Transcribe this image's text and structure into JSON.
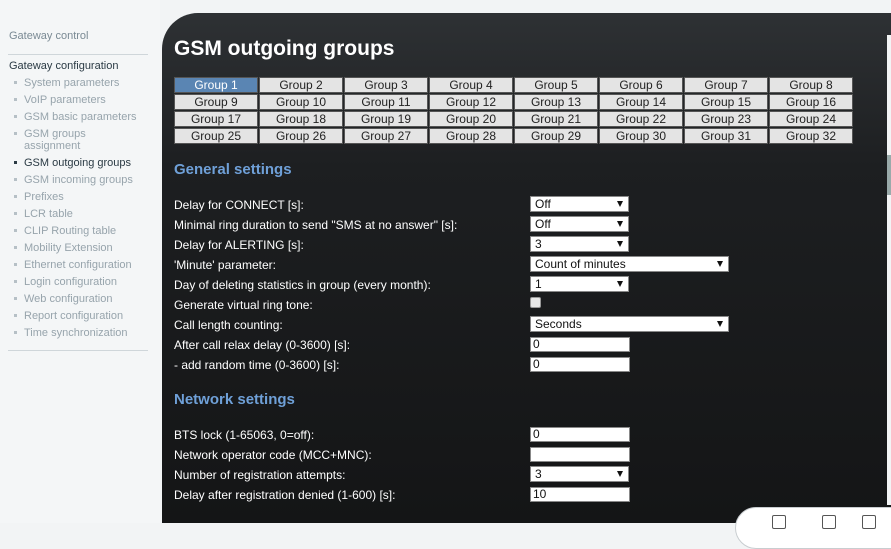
{
  "sidebar": {
    "top_link": "Gateway control",
    "section": "Gateway configuration",
    "items": [
      {
        "label": "System parameters",
        "active": false
      },
      {
        "label": "VoIP parameters",
        "active": false
      },
      {
        "label": "GSM basic parameters",
        "active": false
      },
      {
        "label": "GSM groups assignment",
        "active": false
      },
      {
        "label": "GSM outgoing groups",
        "active": true
      },
      {
        "label": "GSM incoming groups",
        "active": false
      },
      {
        "label": "Prefixes",
        "active": false
      },
      {
        "label": "LCR table",
        "active": false
      },
      {
        "label": "CLIP Routing table",
        "active": false
      },
      {
        "label": "Mobility Extension",
        "active": false
      },
      {
        "label": "Ethernet configuration",
        "active": false
      },
      {
        "label": "Login configuration",
        "active": false
      },
      {
        "label": "Web configuration",
        "active": false
      },
      {
        "label": "Report configuration",
        "active": false
      },
      {
        "label": "Time synchronization",
        "active": false
      }
    ]
  },
  "main": {
    "title": "GSM outgoing groups",
    "groups": [
      "Group 1",
      "Group 2",
      "Group 3",
      "Group 4",
      "Group 5",
      "Group 6",
      "Group 7",
      "Group 8",
      "Group 9",
      "Group 10",
      "Group 11",
      "Group 12",
      "Group 13",
      "Group 14",
      "Group 15",
      "Group 16",
      "Group 17",
      "Group 18",
      "Group 19",
      "Group 20",
      "Group 21",
      "Group 22",
      "Group 23",
      "Group 24",
      "Group 25",
      "Group 26",
      "Group 27",
      "Group 28",
      "Group 29",
      "Group 30",
      "Group 31",
      "Group 32"
    ],
    "active_group": "Group 1",
    "general": {
      "title": "General settings",
      "delay_connect": {
        "label": "Delay for CONNECT [s]:",
        "value": "Off"
      },
      "min_ring": {
        "label": "Minimal ring duration to send \"SMS at no answer\" [s]:",
        "value": "Off"
      },
      "delay_alerting": {
        "label": "Delay for ALERTING [s]:",
        "value": "3"
      },
      "minute_param": {
        "label": "'Minute' parameter:",
        "value": "Count of minutes"
      },
      "day_delete": {
        "label": "Day of deleting statistics in group (every month):",
        "value": "1"
      },
      "virtual_ring": {
        "label": "Generate virtual ring tone:",
        "checked": false
      },
      "call_length": {
        "label": "Call length counting:",
        "value": "Seconds"
      },
      "relax_delay": {
        "label": "After call relax delay (0-3600) [s]:",
        "value": "0"
      },
      "random_time": {
        "label": "- add random time (0-3600) [s]:",
        "value": "0"
      }
    },
    "network": {
      "title": "Network settings",
      "bts_lock": {
        "label": "BTS lock (1-65063, 0=off):",
        "value": "0"
      },
      "operator_code": {
        "label": "Network operator code (MCC+MNC):",
        "value": ""
      },
      "reg_attempts": {
        "label": "Number of registration attempts:",
        "value": "3"
      },
      "reg_denied_delay": {
        "label": "Delay after registration denied (1-600) [s]:",
        "value": "10"
      }
    }
  },
  "colors": {
    "accent_blue": "#6fa0d8",
    "active_tab": "#5a85b3",
    "panel_dark": "#1d1f21"
  }
}
